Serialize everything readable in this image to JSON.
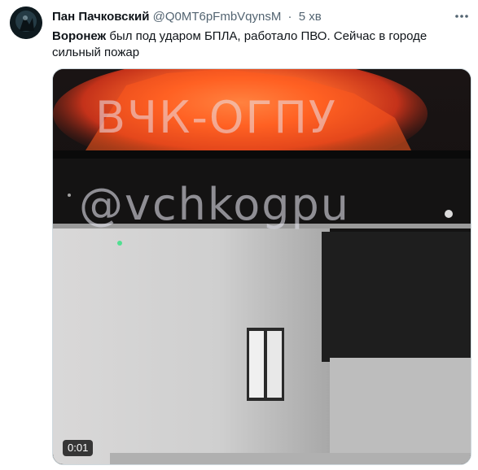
{
  "tweet": {
    "author_name": "Пан Пачковский",
    "author_handle": "@Q0MT6pFmbVqynsM",
    "separator": "·",
    "time": "5 хв",
    "more_icon": "more-icon",
    "text_bold": "Воронеж",
    "text_rest": " был под ударом БПЛА, работало ПВО. Сейчас в городе сильный пожар"
  },
  "media": {
    "watermark_top": "ВЧК-ОГПУ",
    "watermark_handle": "@vchkogpu",
    "duration": "0:01"
  },
  "colors": {
    "text_primary": "#0f1419",
    "text_secondary": "#536471",
    "border": "#cfd9de",
    "fire": "#ff5a1e"
  }
}
